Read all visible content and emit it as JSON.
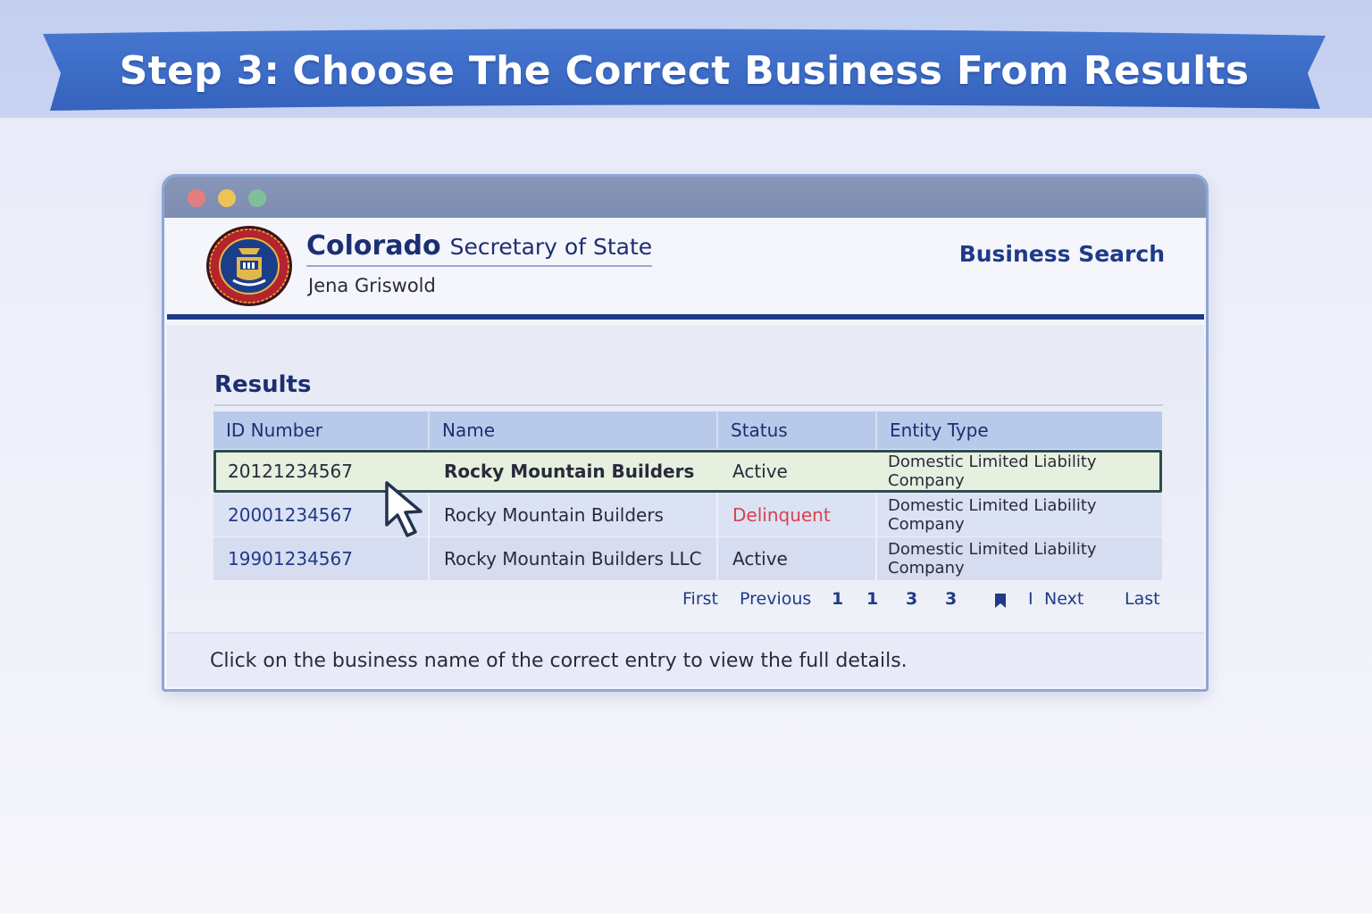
{
  "banner": {
    "step": "Step 3:",
    "title": "Choose The Correct Business From Results"
  },
  "window": {
    "controls": [
      "close-dot",
      "minimize-dot",
      "zoom-dot"
    ]
  },
  "site": {
    "brand": "Colorado",
    "department": "Secretary of State",
    "official": "Jena Griswold",
    "section": "Business Search"
  },
  "results": {
    "heading": "Results",
    "columns": [
      "ID Number",
      "Name",
      "Status",
      "Entity Type"
    ],
    "rows": [
      {
        "id": "20121234567",
        "name": "Rocky Mountain Builders",
        "status": "Active",
        "entity_type": "Domestic Limited Liability Company",
        "selected": true
      },
      {
        "id": "20001234567",
        "name": "Rocky Mountain Builders",
        "status": "Delinquent",
        "entity_type": "Domestic Limited Liability Company",
        "selected": false
      },
      {
        "id": "19901234567",
        "name": "Rocky Mountain Builders LLC",
        "status": "Active",
        "entity_type": "Domestic Limited Liability Company",
        "selected": false
      }
    ]
  },
  "pagination": {
    "first": "First",
    "previous": "Previous",
    "pages": [
      "1",
      "1",
      "3",
      "3"
    ],
    "separator": "I",
    "next": "Next",
    "last": "Last"
  },
  "instruction": "Click on the business name of the correct entry to view the full details.",
  "colors": {
    "banner": "#3f6fc9",
    "header_rule": "#1f3b88",
    "delinquent": "#d6424f",
    "selected_row": "#e6f0df"
  },
  "icons": {
    "seal": "colorado-seal-icon",
    "pointer": "mouse-pointer-icon",
    "bookmark": "bookmark-icon"
  }
}
